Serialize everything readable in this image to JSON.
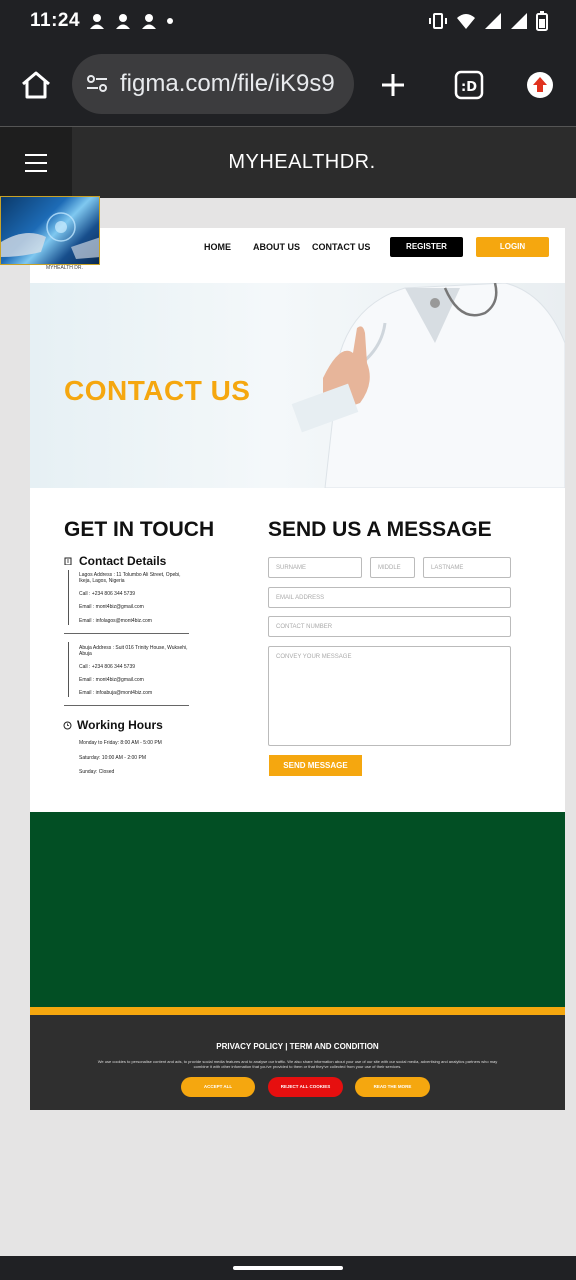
{
  "status_bar": {
    "time": "11:24"
  },
  "browser": {
    "url": "figma.com/file/iK9s9"
  },
  "figma": {
    "title": "MYHEALTHDR."
  },
  "site": {
    "logo_text": "MYHEALTH DR.",
    "nav": {
      "home": "HOME",
      "about": "ABOUT US",
      "contact": "CONTACT US",
      "register": "REGISTER",
      "login": "LOGIN"
    },
    "hero": {
      "title": "CONTACT US"
    },
    "get_in_touch": {
      "title": "GET IN TOUCH",
      "details_title": "Contact Details",
      "lagos": {
        "address": "Lagos Address : 11 Tolumbo Ali Street, Opebi, Ikeja, Lagos, Nigeria",
        "call": "Call : +234 806 344 5739",
        "email1": "Email : mont4biz@gmail.com",
        "email2": "Email : infolagos@mont4biz.com"
      },
      "abuja": {
        "address": "Abuja Address : Suit 016 Trinity House, Wuksehi, Abuja",
        "call": "Call : +234 806 344 5739",
        "email1": "Email : mont4biz@gmail.com",
        "email2": "Email : infoabuja@mont4biz.com"
      },
      "hours_title": "Working Hours",
      "hours": [
        "Monday to Friday: 8:00 AM - 5:00 PM",
        "Saturday: 10:00 AM - 2:00 PM",
        "Sunday: Closed"
      ]
    },
    "message_form": {
      "title": "SEND US A MESSAGE",
      "surname": "SURNAME",
      "middle": "MIDDLE",
      "lastname": "LASTNAME",
      "email": "EMAIL ADDRESS",
      "contact": "CONTACT NUMBER",
      "message": "CONVEY YOUR MESSAGE",
      "send": "SEND MESSAGE"
    },
    "cookies": {
      "title": "PRIVACY POLICY | TERM AND  CONDITION",
      "text": "We use cookies to personalise content and ads, to provide social media features and to analyse our traffic. We also share information about your use of our site with our social media, advertising and analytics partners who may combine it with other information that you've provided to them or that they've collected from your use of their services.",
      "accept": "ACCEPT ALL",
      "reject": "REJECT ALL COOKIES",
      "read_more": "READ THE MORE"
    }
  },
  "colors": {
    "accent": "#f5a70f",
    "green": "#024f24",
    "reject": "#e60f0f"
  }
}
